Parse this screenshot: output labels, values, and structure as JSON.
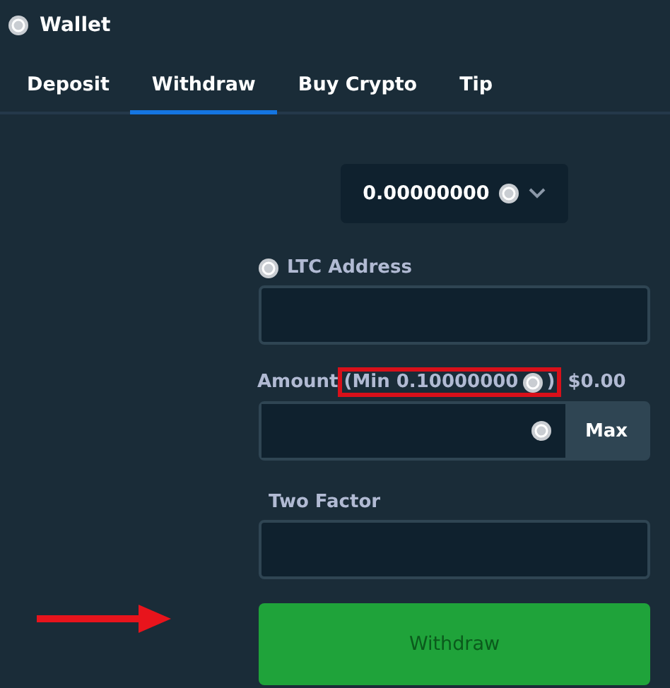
{
  "header": {
    "title": "Wallet"
  },
  "tabs": [
    {
      "label": "Deposit",
      "selected": false
    },
    {
      "label": "Withdraw",
      "selected": true
    },
    {
      "label": "Buy Crypto",
      "selected": false
    },
    {
      "label": "Tip",
      "selected": false
    }
  ],
  "balance": {
    "value": "0.00000000"
  },
  "address": {
    "label": "LTC Address"
  },
  "amount": {
    "label": "Amount",
    "min_text": "(Min 0.10000000",
    "min_close": ")",
    "highlighted": true,
    "usd": "$0.00",
    "max_button": "Max"
  },
  "two_factor": {
    "label": "Two Factor"
  },
  "submit": {
    "label": "Withdraw",
    "pointed_at": true
  }
}
